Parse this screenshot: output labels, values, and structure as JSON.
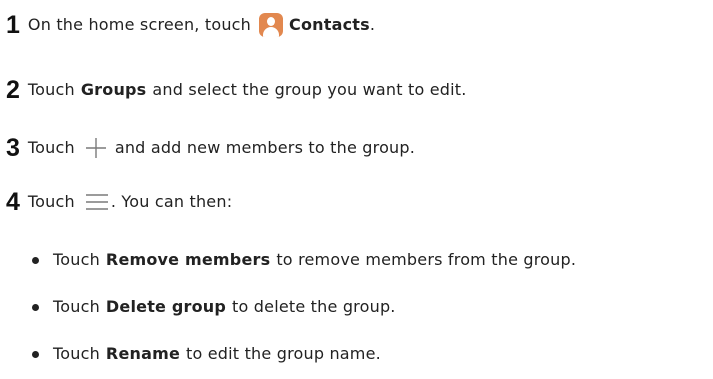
{
  "steps": [
    {
      "num": "1",
      "pre": "On the home screen, touch",
      "icon": "contacts-app-icon",
      "bold": "Contacts",
      "post": "."
    },
    {
      "num": "2",
      "pre": "Touch",
      "bold": "Groups",
      "post": "and select the group you want to edit."
    },
    {
      "num": "3",
      "pre": "Touch",
      "icon": "plus-icon",
      "post": "and add new members to the group."
    },
    {
      "num": "4",
      "pre": "Touch",
      "icon": "menu-icon",
      "post": ". You can then:"
    }
  ],
  "bullets": [
    {
      "pre": "Touch",
      "bold": "Remove members",
      "post": "to remove members from the group."
    },
    {
      "pre": "Touch",
      "bold": "Delete group",
      "post": "to delete the group."
    },
    {
      "pre": "Touch",
      "bold": "Rename",
      "post": "to edit the group name."
    }
  ],
  "colors": {
    "text": "#222222",
    "contacts_icon": "#e2884f",
    "line_icon": "#7a7a7a"
  }
}
